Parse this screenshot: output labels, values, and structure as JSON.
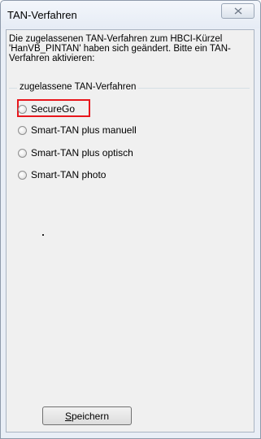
{
  "window": {
    "title": "TAN-Verfahren"
  },
  "dialog": {
    "description": "Die zugelassenen TAN-Verfahren zum HBCI-Kürzel 'HanVB_PINTAN' haben sich geändert. Bitte ein TAN-Verfahren aktivieren:",
    "group_label": "zugelassene TAN-Verfahren",
    "options": [
      {
        "label": "SecureGo",
        "selected": false,
        "highlighted": true
      },
      {
        "label": "Smart-TAN plus manuell",
        "selected": false
      },
      {
        "label": "Smart-TAN plus optisch",
        "selected": false
      },
      {
        "label": "Smart-TAN photo",
        "selected": false
      }
    ],
    "save_button": {
      "mnemonic": "S",
      "rest": "peichern"
    }
  },
  "colors": {
    "highlight": "#e8161c"
  },
  "icons": {
    "close": "close-x-icon"
  }
}
